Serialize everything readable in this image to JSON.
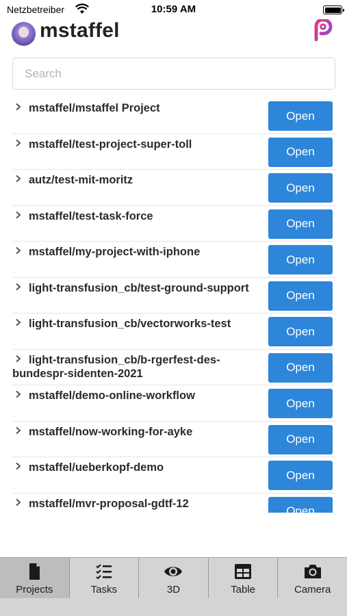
{
  "status_bar": {
    "carrier": "Netzbetreiber",
    "time": "10:59 AM",
    "icons": [
      "wifi-icon",
      "battery-icon"
    ]
  },
  "header": {
    "title": "mstaffel",
    "avatar_icon": "user-avatar",
    "brand_icon": "p-logo-icon",
    "brand_colors": [
      "#e0308a",
      "#7b4fd6"
    ]
  },
  "search": {
    "placeholder": "Search",
    "value": ""
  },
  "open_button_color": "#2d86d9",
  "projects": [
    {
      "name": "mstaffel/mstaffel Project",
      "action": "Open"
    },
    {
      "name": "mstaffel/test-project-super-toll",
      "action": "Open"
    },
    {
      "name": "autz/test-mit-moritz",
      "action": "Open"
    },
    {
      "name": "mstaffel/test-task-force",
      "action": "Open"
    },
    {
      "name": "mstaffel/my-project-with-iphone",
      "action": "Open"
    },
    {
      "name": "light-transfusion_cb/test-ground-support",
      "action": "Open"
    },
    {
      "name": "light-transfusion_cb/vectorworks-test",
      "action": "Open"
    },
    {
      "name": "light-transfusion_cb/b-rgerfest-des-bundespr-sidenten-2021",
      "action": "Open"
    },
    {
      "name": "mstaffel/demo-online-workflow",
      "action": "Open"
    },
    {
      "name": "mstaffel/now-working-for-ayke",
      "action": "Open"
    },
    {
      "name": "mstaffel/ueberkopf-demo",
      "action": "Open"
    },
    {
      "name": "mstaffel/mvr-proposal-gdtf-12",
      "action": "Open"
    }
  ],
  "tabs": [
    {
      "label": "Projects",
      "icon": "document-icon",
      "active": true
    },
    {
      "label": "Tasks",
      "icon": "checklist-icon",
      "active": false
    },
    {
      "label": "3D",
      "icon": "eye-icon",
      "active": false
    },
    {
      "label": "Table",
      "icon": "table-icon",
      "active": false
    },
    {
      "label": "Camera",
      "icon": "camera-icon",
      "active": false
    }
  ]
}
